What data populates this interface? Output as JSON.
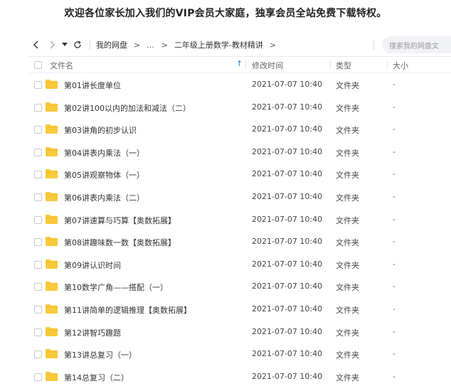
{
  "banner": "欢迎各位家长加入我们的VIP会员大家庭，独享会员全站免费下载特权。",
  "toolbar": {
    "breadcrumb_root": "我的网盘",
    "breadcrumb_ellipsis": "...",
    "breadcrumb_current": "二年级上册数学-教材精讲",
    "breadcrumb_separator": ">",
    "search_placeholder": "搜索我的网盘文"
  },
  "header": {
    "name": "文件名",
    "sort_icon": "↑",
    "modified": "修改时间",
    "type": "类型",
    "size": "大小"
  },
  "colors": {
    "accent": "#2b7df6",
    "folder": "#f8c93a"
  },
  "files": [
    {
      "name": "第01讲长度单位",
      "modified": "2021-07-07 10:40",
      "type": "文件夹",
      "size": "-"
    },
    {
      "name": "第02讲100以内的加法和减法（二）",
      "modified": "2021-07-07 10:40",
      "type": "文件夹",
      "size": "-"
    },
    {
      "name": "第03讲角的初步认识",
      "modified": "2021-07-07 10:40",
      "type": "文件夹",
      "size": "-"
    },
    {
      "name": "第04讲表内乘法（一）",
      "modified": "2021-07-07 10:40",
      "type": "文件夹",
      "size": "-"
    },
    {
      "name": "第05讲观察物体（一）",
      "modified": "2021-07-07 10:40",
      "type": "文件夹",
      "size": "-"
    },
    {
      "name": "第06讲表内乘法（二）",
      "modified": "2021-07-07 10:40",
      "type": "文件夹",
      "size": "-"
    },
    {
      "name": "第07讲速算与巧算【奥数拓展】",
      "modified": "2021-07-07 10:40",
      "type": "文件夹",
      "size": "-"
    },
    {
      "name": "第08讲趣味数一数【奥数拓展】",
      "modified": "2021-07-07 10:40",
      "type": "文件夹",
      "size": "-"
    },
    {
      "name": "第09讲认识时间",
      "modified": "2021-07-07 10:40",
      "type": "文件夹",
      "size": "-"
    },
    {
      "name": "第10数学广角——搭配（一）",
      "modified": "2021-07-07 10:40",
      "type": "文件夹",
      "size": "-"
    },
    {
      "name": "第11讲简单的逻辑推理【奥数拓展】",
      "modified": "2021-07-07 10:40",
      "type": "文件夹",
      "size": "-"
    },
    {
      "name": "第12讲智巧趣题",
      "modified": "2021-07-07 10:40",
      "type": "文件夹",
      "size": "-"
    },
    {
      "name": "第13讲总复习（一）",
      "modified": "2021-07-07 10:40",
      "type": "文件夹",
      "size": "-"
    },
    {
      "name": "第14总复习（二）",
      "modified": "2021-07-07 10:40",
      "type": "文件夹",
      "size": "-"
    }
  ]
}
